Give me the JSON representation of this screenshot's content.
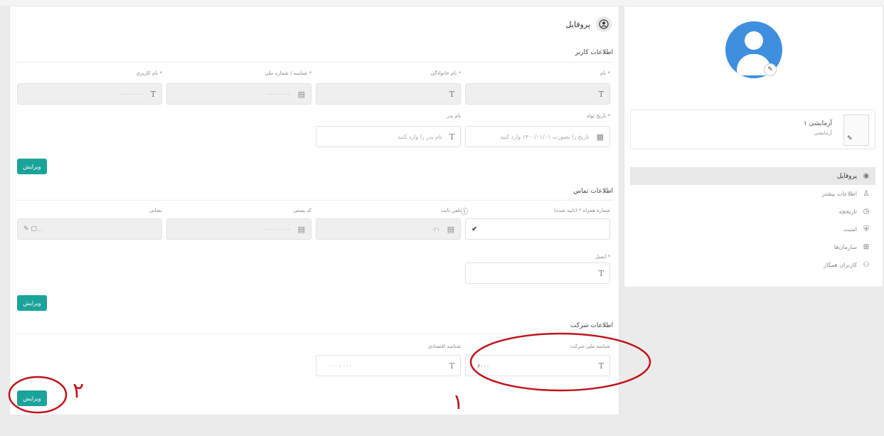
{
  "page": {
    "title": "پروفایل"
  },
  "personal": {
    "section_title": "اطلاعات کاربر",
    "first_name": {
      "label": "نام *",
      "value": ""
    },
    "last_name": {
      "label": "نام خانوادگی *",
      "value": ""
    },
    "national_id": {
      "label": "شناسه / شماره ملی *",
      "value": "۰۰۰۰۰۰۰۰"
    },
    "username": {
      "label": "نام کاربری *",
      "value": "۰۰۰۰۰۰۰۰"
    },
    "birth_date": {
      "label": "تاریخ تولد *",
      "placeholder": "تاریخ را بصورت ۱۴۰۰/۰۱/۰۱ وارد کنید"
    },
    "father_name": {
      "label": "نام پدر",
      "placeholder": "نام پدر را وارد کنید"
    },
    "save_label": "ویرایش"
  },
  "contact": {
    "section_title": "اطلاعات تماس",
    "mobile": {
      "label": "شماره همراه * (تایید شده)",
      "value": ""
    },
    "phone": {
      "label": "تلفن ثابت",
      "value": "۰۲۱"
    },
    "postal_code": {
      "label": "کد پستی",
      "value": "۰۰۰۰۰۰۰۰۰"
    },
    "address": {
      "label": "نشانی",
      "value": "...",
      "placeholder": ""
    },
    "email": {
      "label": "ایمیل *",
      "value": ""
    },
    "save_label": "ویرایش"
  },
  "company": {
    "section_title": "اطلاعات شرکت",
    "company_id": {
      "label": "شناسه ملی شرکت",
      "value": "۶۰۰۰"
    },
    "economic_code": {
      "label": "شناسه اقتصادی",
      "value": "۰۰۰ - ۰۰۰"
    },
    "save_label": "ویرایش"
  },
  "sidebar": {
    "org_name": "آزمایشی ۱",
    "org_sub": "آزمایشی",
    "items": [
      {
        "label": "پروفایل",
        "icon": "user-circle-icon",
        "active": true
      },
      {
        "label": "اطلاعات بیشتر",
        "icon": "user-icon",
        "active": false
      },
      {
        "label": "تاریخچه",
        "icon": "history-icon",
        "active": false
      },
      {
        "label": "امنیت",
        "icon": "shield-icon",
        "active": false
      },
      {
        "label": "سازمان‌ها",
        "icon": "org-icon",
        "active": false
      },
      {
        "label": "کاربران همکار",
        "icon": "users-icon",
        "active": false
      }
    ]
  },
  "annotations": {
    "mark_1": "۱",
    "mark_2": "۲",
    "color": "#c0141b"
  },
  "colors": {
    "accent": "#1aa39a",
    "avatar": "#3f8fdf"
  }
}
